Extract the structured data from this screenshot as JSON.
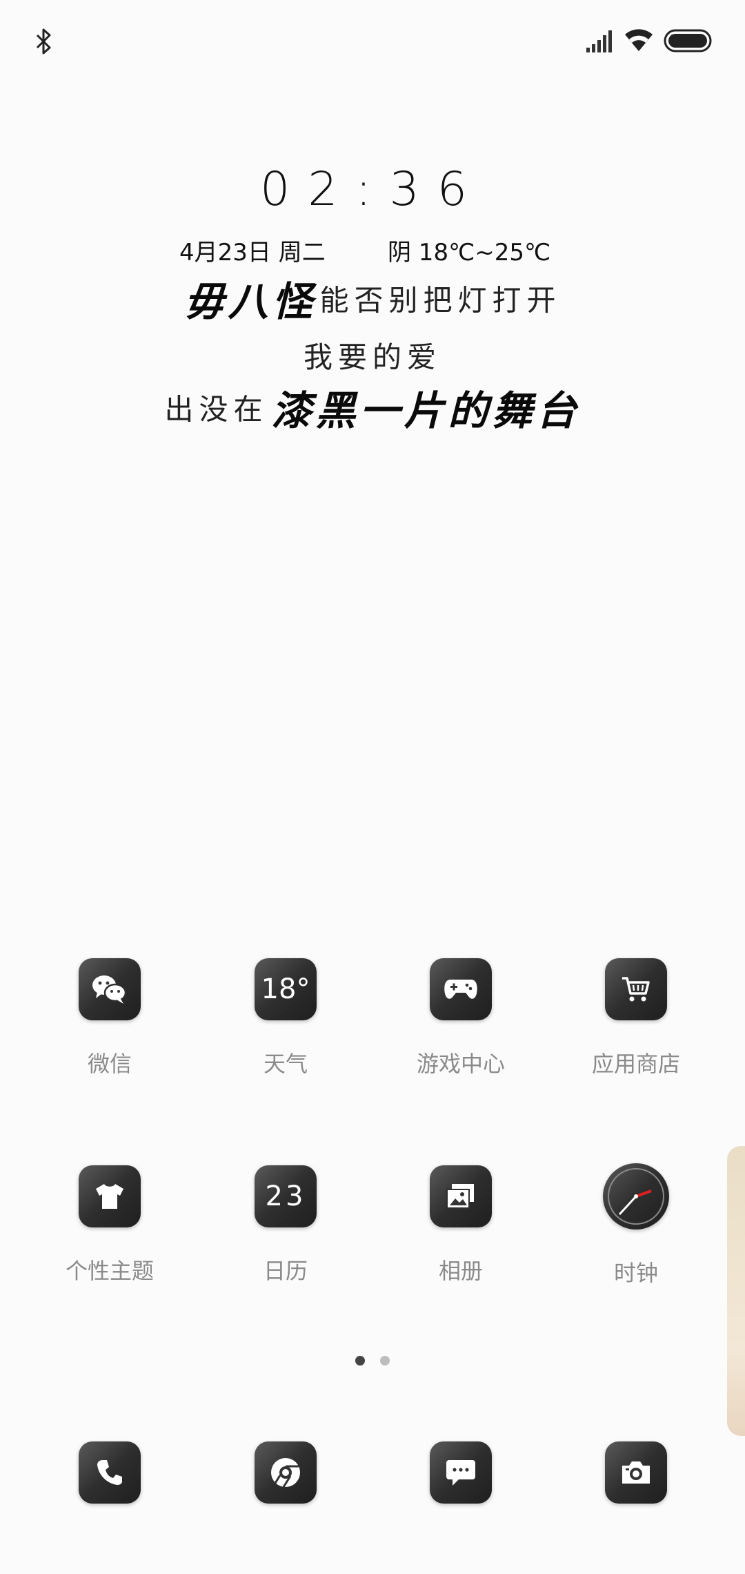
{
  "status_bar": {
    "icons": [
      "bluetooth-icon",
      "signal-icon",
      "wifi-icon",
      "battery-icon"
    ]
  },
  "clock_widget": {
    "time": "02:36",
    "date": "4月23日 周二",
    "weather": "阴 18℃~25℃"
  },
  "lyrics": {
    "line1_bold": "毋八怪",
    "line1_thin": "能否别把灯打开",
    "line2_thin": "我要的爱",
    "line3_thin": "出没在",
    "line3_bold": "漆黑一片的舞台"
  },
  "apps": [
    {
      "label": "微信",
      "icon": "wechat-icon"
    },
    {
      "label": "天气",
      "icon": "weather-icon",
      "icon_text": "18°"
    },
    {
      "label": "游戏中心",
      "icon": "gamepad-icon"
    },
    {
      "label": "应用商店",
      "icon": "cart-icon"
    },
    {
      "label": "个性主题",
      "icon": "tshirt-icon"
    },
    {
      "label": "日历",
      "icon": "calendar-icon",
      "icon_text": "23"
    },
    {
      "label": "相册",
      "icon": "gallery-icon"
    },
    {
      "label": "时钟",
      "icon": "clock-icon"
    }
  ],
  "page_indicator": {
    "pages": 2,
    "current": 1
  },
  "dock": [
    {
      "icon": "phone-icon"
    },
    {
      "icon": "browser-icon"
    },
    {
      "icon": "messages-icon"
    },
    {
      "icon": "camera-icon"
    }
  ]
}
